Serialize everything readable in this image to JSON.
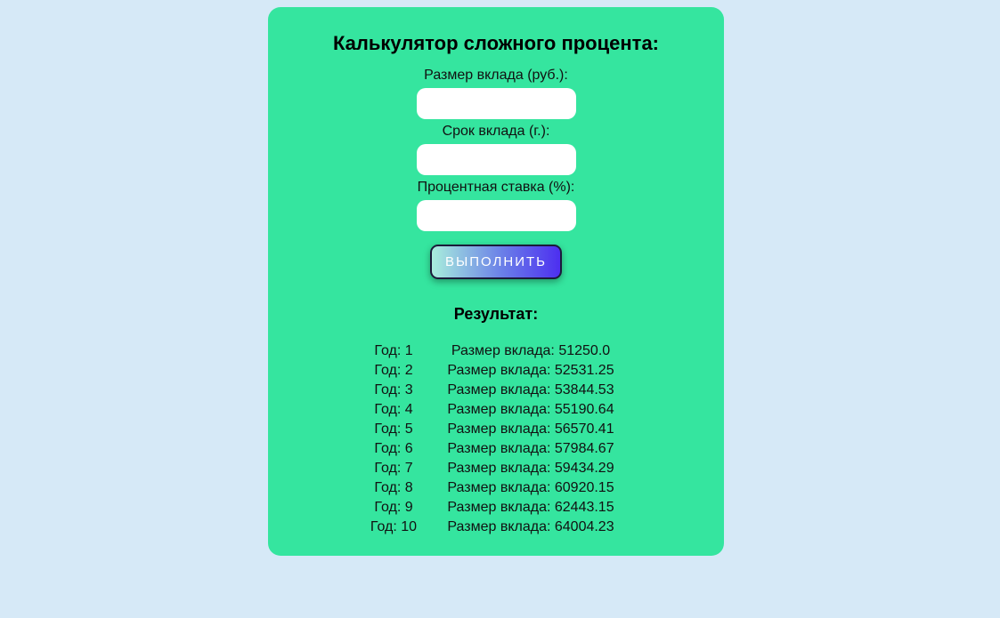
{
  "form": {
    "title": "Калькулятор сложного процента:",
    "deposit_label": "Размер вклада (руб.):",
    "deposit_value": "",
    "term_label": "Срок вклада (г.):",
    "term_value": "",
    "rate_label": "Процентная ставка (%):",
    "rate_value": "",
    "submit_label": "ВЫПОЛНИТЬ"
  },
  "result": {
    "title": "Результат:",
    "rows": [
      {
        "year": "Год: 1",
        "deposit": "Размер вклада: 51250.0"
      },
      {
        "year": "Год: 2",
        "deposit": "Размер вклада: 52531.25"
      },
      {
        "year": "Год: 3",
        "deposit": "Размер вклада: 53844.53"
      },
      {
        "year": "Год: 4",
        "deposit": "Размер вклада: 55190.64"
      },
      {
        "year": "Год: 5",
        "deposit": "Размер вклада: 56570.41"
      },
      {
        "year": "Год: 6",
        "deposit": "Размер вклада: 57984.67"
      },
      {
        "year": "Год: 7",
        "deposit": "Размер вклада: 59434.29"
      },
      {
        "year": "Год: 8",
        "deposit": "Размер вклада: 60920.15"
      },
      {
        "year": "Год: 9",
        "deposit": "Размер вклада: 62443.15"
      },
      {
        "year": "Год: 10",
        "deposit": "Размер вклада: 64004.23"
      }
    ]
  },
  "colors": {
    "page_background": "#d6e9f7",
    "card_background": "#35e59f",
    "button_gradient_start": "#a8eedc",
    "button_gradient_end": "#4d2ff0"
  }
}
